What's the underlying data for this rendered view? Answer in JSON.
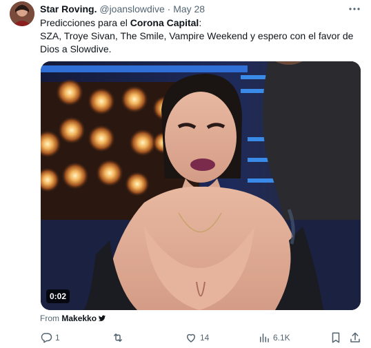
{
  "tweet": {
    "display_name": "Star Roving.",
    "handle": "@joanslowdive",
    "separator": "·",
    "date": "May 28",
    "text_intro": "Predicciones para el ",
    "text_bold": "Corona Capital",
    "text_colon": ":",
    "text_line2": "SZA, Troye Sivan, The Smile, Vampire Weekend y espero con el favor de Dios a Slowdive."
  },
  "media": {
    "duration": "0:02"
  },
  "attribution": {
    "prefix": "From",
    "name": "Makekko"
  },
  "actions": {
    "reply_count": "1",
    "retweet_count": "",
    "like_count": "14",
    "views_count": "6.1K"
  },
  "colors": {
    "text_primary": "#0f1419",
    "text_secondary": "#536471"
  },
  "icons": [
    "more-icon",
    "verified-bird-icon",
    "reply-icon",
    "retweet-icon",
    "like-icon",
    "views-icon",
    "bookmark-icon",
    "share-icon"
  ]
}
